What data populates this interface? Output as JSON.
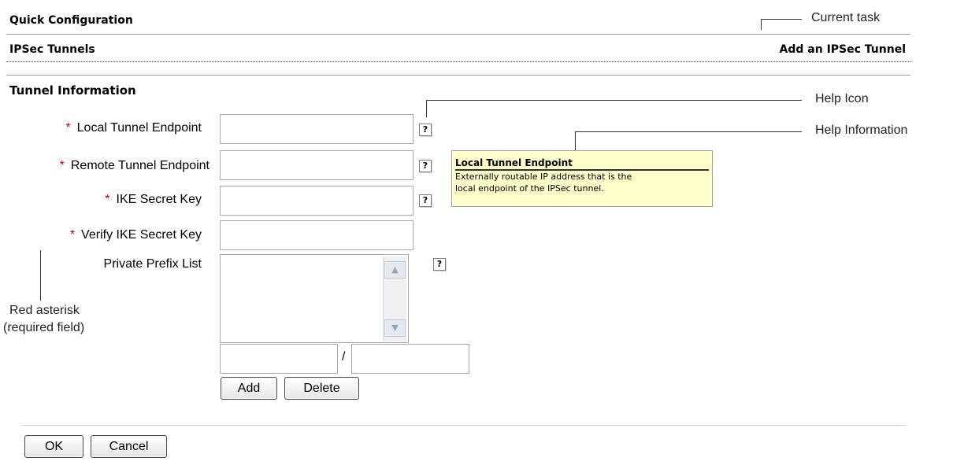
{
  "header": {
    "title": "Quick Configuration",
    "section": "IPSec Tunnels",
    "current_task": "Add an IPSec Tunnel"
  },
  "form": {
    "heading": "Tunnel Information",
    "required_mark": "*",
    "fields": {
      "local_endpoint": {
        "label": "Local Tunnel Endpoint",
        "value": ""
      },
      "remote_endpoint": {
        "label": "Remote Tunnel Endpoint",
        "value": ""
      },
      "ike_key": {
        "label": "IKE Secret Key",
        "value": ""
      },
      "verify_ike_key": {
        "label": "Verify IKE Secret Key",
        "value": ""
      },
      "private_prefix": {
        "label": "Private Prefix List",
        "separator": "/"
      }
    },
    "help_glyph": "?",
    "add_label": "Add",
    "delete_label": "Delete",
    "ok_label": "OK",
    "cancel_label": "Cancel"
  },
  "tooltip": {
    "title": "Local Tunnel Endpoint",
    "body_line1": "Externally routable IP address that is the",
    "body_line2": "local endpoint of the IPSec tunnel."
  },
  "annotations": {
    "current_task": "Current task",
    "help_icon": "Help Icon",
    "help_information": "Help Information",
    "red_asterisk_line1": "Red asterisk",
    "red_asterisk_line2": "(required field)"
  },
  "icons": {
    "scroll_up": "scroll-up-arrow-icon",
    "scroll_down": "scroll-down-arrow-icon",
    "help": "help-icon"
  },
  "colors": {
    "required": "#cc0000",
    "tooltip_bg": "#ffffcc"
  }
}
